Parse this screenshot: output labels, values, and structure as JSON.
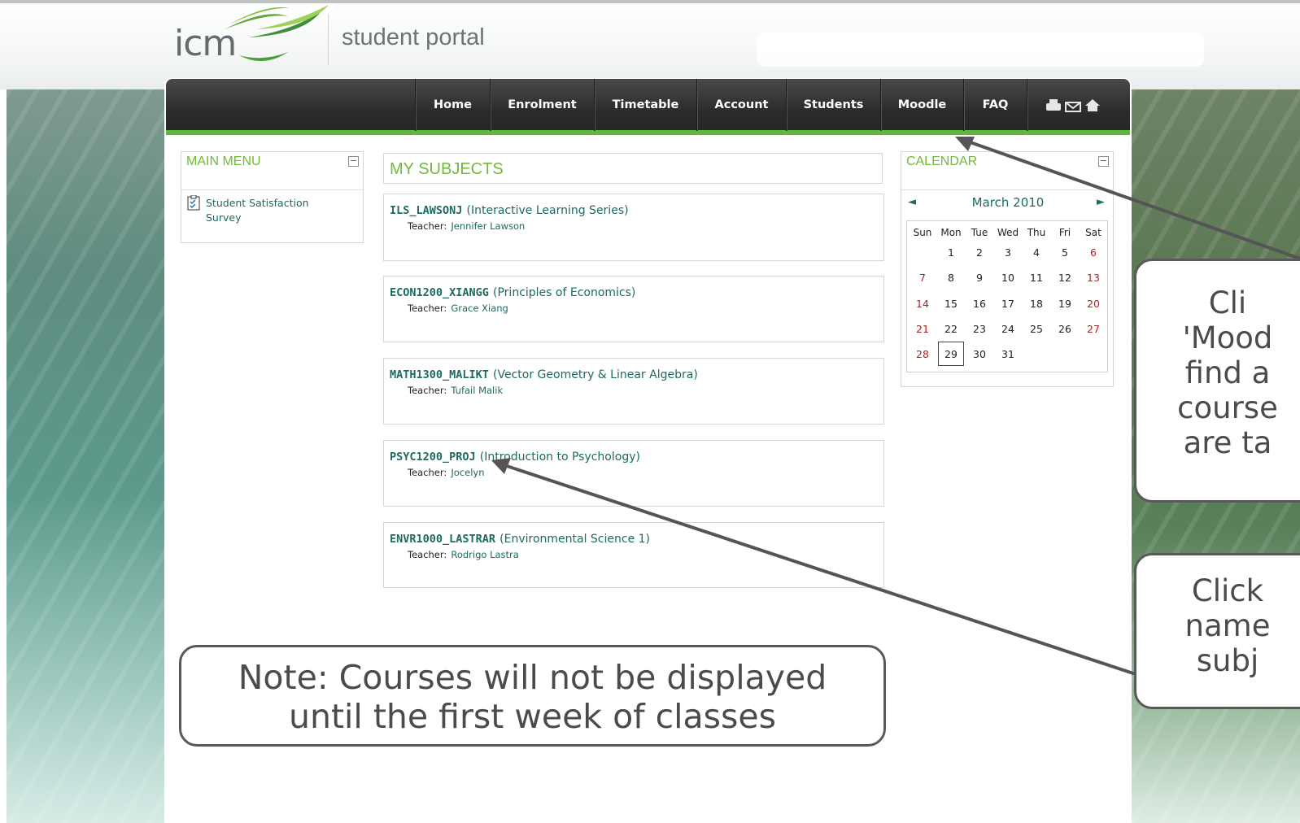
{
  "header": {
    "logo_text": "icm",
    "portal_title": "student portal"
  },
  "nav": {
    "items": [
      "Home",
      "Enrolment",
      "Timetable",
      "Account",
      "Students",
      "Moodle",
      "FAQ"
    ],
    "icons": [
      "print-icon",
      "mail-icon",
      "home-icon"
    ]
  },
  "main_menu": {
    "title": "MAIN MENU",
    "items": [
      {
        "label_line1": "Student Satisfaction",
        "label_line2": "Survey",
        "icon": "survey-icon"
      }
    ]
  },
  "subjects": {
    "title": "MY SUBJECTS",
    "teacher_label": "Teacher:",
    "items": [
      {
        "code": "ILS_LAWSONJ",
        "name": "(Interactive Learning Series)",
        "teacher": "Jennifer Lawson"
      },
      {
        "code": "ECON1200_XIANGG",
        "name": "(Principles of Economics)",
        "teacher": "Grace Xiang"
      },
      {
        "code": "MATH1300_MALIKT",
        "name": "(Vector Geometry & Linear Algebra)",
        "teacher": "Tufail Malik"
      },
      {
        "code": "PSYC1200_PROJ",
        "name": "(Introduction to Psychology)",
        "teacher": "Jocelyn"
      },
      {
        "code": "ENVR1000_LASTRAR",
        "name": "(Environmental Science 1)",
        "teacher": "Rodrigo Lastra"
      }
    ]
  },
  "calendar": {
    "title": "CALENDAR",
    "month": "March 2010",
    "prev": "◄",
    "next": "►",
    "weekdays": [
      "Sun",
      "Mon",
      "Tue",
      "Wed",
      "Thu",
      "Fri",
      "Sat"
    ],
    "weeks": [
      [
        "",
        "1",
        "2",
        "3",
        "4",
        "5",
        "6"
      ],
      [
        "7",
        "8",
        "9",
        "10",
        "11",
        "12",
        "13"
      ],
      [
        "14",
        "15",
        "16",
        "17",
        "18",
        "19",
        "20"
      ],
      [
        "21",
        "22",
        "23",
        "24",
        "25",
        "26",
        "27"
      ],
      [
        "28",
        "29",
        "30",
        "31",
        "",
        "",
        ""
      ]
    ],
    "today": "29"
  },
  "annotations": {
    "moodle_tip": [
      "Cli",
      "'Mood",
      "find a",
      "course",
      "are ta"
    ],
    "subject_tip": [
      "Click",
      "name",
      "subj"
    ],
    "note": [
      "Note: Courses will not be displayed",
      "until the first week of classes"
    ]
  },
  "colors": {
    "accent_green": "#72b83b",
    "nav_green": "#5fb83d",
    "link_teal": "#1d6a5f",
    "weekend_red": "#b02020"
  }
}
